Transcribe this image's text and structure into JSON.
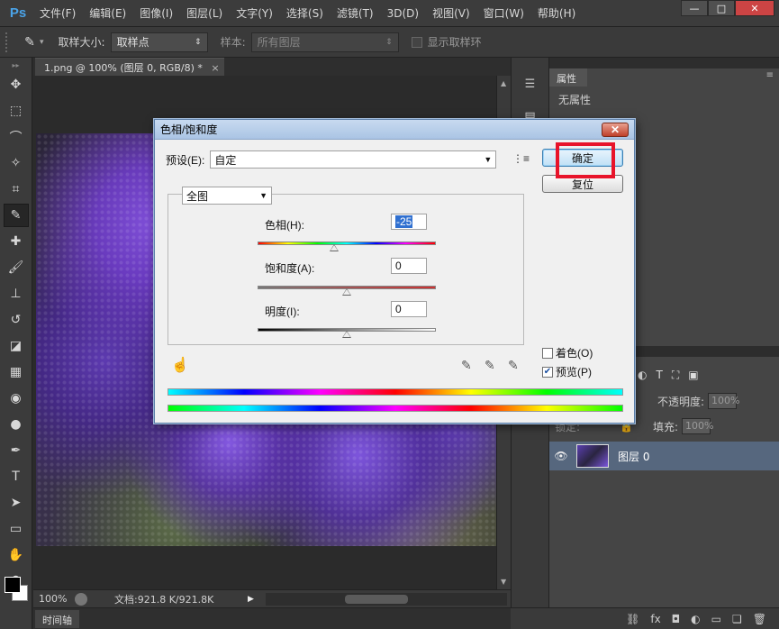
{
  "app": {
    "logo": "Ps",
    "menu": [
      "文件(F)",
      "编辑(E)",
      "图像(I)",
      "图层(L)",
      "文字(Y)",
      "选择(S)",
      "滤镜(T)",
      "3D(D)",
      "视图(V)",
      "窗口(W)",
      "帮助(H)"
    ],
    "window_controls": [
      "—",
      "□",
      "✕"
    ]
  },
  "options": {
    "sample_size_label": "取样大小:",
    "sample_size_value": "取样点",
    "sample_label": "样本:",
    "sample_value": "所有图层",
    "show_ring_label": "显示取样环"
  },
  "document": {
    "tab_title": "1.png @ 100% (图层 0, RGB/8) *",
    "tab_close": "×",
    "zoom": "100%",
    "doc_info": "文档:921.8 K/921.8K",
    "timeline_label": "时间轴"
  },
  "panels": {
    "properties_tab": "属性",
    "no_properties": "无属性",
    "opacity_label": "不透明度:",
    "opacity_value": "100%",
    "fill_label": "填充:",
    "fill_value": "100%",
    "layer_name": "图层 0",
    "lock_label": "锁定:"
  },
  "dialog": {
    "title": "色相/饱和度",
    "close": "✕",
    "preset_label": "预设(E):",
    "preset_value": "自定",
    "range_value": "全图",
    "hue_label": "色相(H):",
    "hue_value": "-25",
    "saturation_label": "饱和度(A):",
    "saturation_value": "0",
    "lightness_label": "明度(I):",
    "lightness_value": "0",
    "ok_label": "确定",
    "reset_label": "复位",
    "colorize_label": "着色(O)",
    "preview_label": "预览(P)",
    "preview_checked": true,
    "colorize_checked": false,
    "hue_level": -25,
    "saturation_level": 0,
    "lightness_level": 0
  },
  "colors": {
    "highlight": "#e8142a",
    "layer_selected": "#56677e",
    "ps_blue": "#4aa3e8"
  }
}
